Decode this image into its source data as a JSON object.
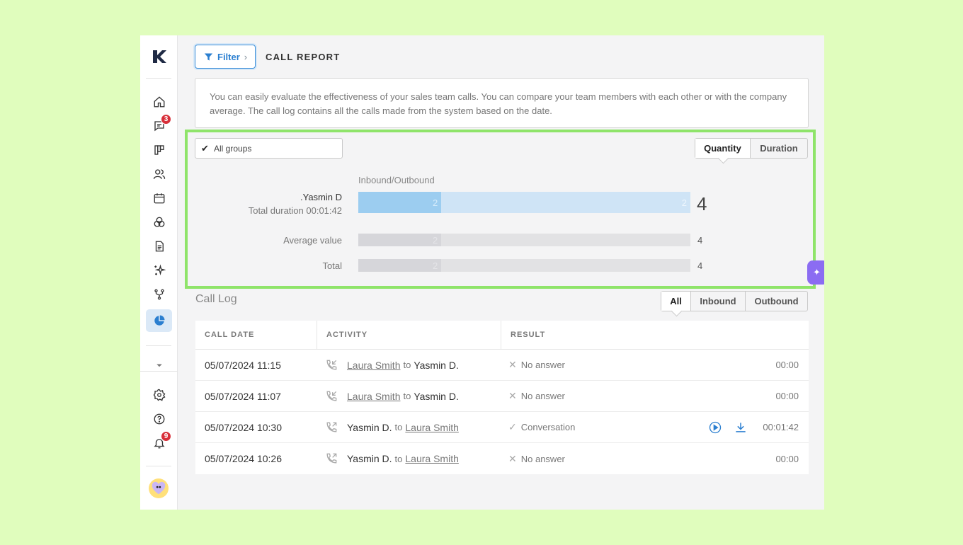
{
  "sidebar": {
    "badges": {
      "messages": "3",
      "notifications": "9"
    }
  },
  "header": {
    "filter_label": "Filter",
    "title": "CALL REPORT"
  },
  "info": "You can easily evaluate the effectiveness of your sales team calls. You can compare your team members with each other or with the company average. The call log contains all the calls made from the system based on the date.",
  "stats": {
    "groups_label": "All groups",
    "toggle": [
      "Quantity",
      "Duration"
    ],
    "selected_toggle": "Quantity",
    "bar_caption": "Inbound/Outbound",
    "user": {
      "name": ".Yasmin D",
      "duration_label": "Total duration 00:01:42",
      "inbound": 2,
      "outbound": 2,
      "total": "4"
    },
    "average": {
      "label": "Average value",
      "inbound": 2,
      "outbound": 2,
      "total": "4"
    },
    "total": {
      "label": "Total",
      "inbound": 2,
      "outbound": 2,
      "total": "4"
    }
  },
  "call_log": {
    "title": "Call Log",
    "filters": [
      "All",
      "Inbound",
      "Outbound"
    ],
    "selected_filter": "All",
    "columns": [
      "CALL DATE",
      "ACTIVITY",
      "RESULT"
    ],
    "rows": [
      {
        "date": "05/07/2024 11:15",
        "direction": "inbound",
        "from": "Laura Smith",
        "to_word": "to",
        "to": "Yasmin D.",
        "result": "No answer",
        "duration": "00:00"
      },
      {
        "date": "05/07/2024 11:07",
        "direction": "inbound",
        "from": "Laura Smith",
        "to_word": "to",
        "to": "Yasmin D.",
        "result": "No answer",
        "duration": "00:00"
      },
      {
        "date": "05/07/2024 10:30",
        "direction": "outbound",
        "from": "Yasmin D.",
        "to_word": "to",
        "to": "Laura Smith",
        "result": "Conversation",
        "duration": "00:01:42"
      },
      {
        "date": "05/07/2024 10:26",
        "direction": "outbound",
        "from": "Yasmin D.",
        "to_word": "to",
        "to": "Laura Smith",
        "result": "No answer",
        "duration": "00:00"
      }
    ]
  },
  "colors": {
    "accent": "#2b7fd0",
    "highlight": "#8fe46a",
    "inbound_bar": "#9ccdf0",
    "outbound_bar": "#cfe4f6"
  }
}
